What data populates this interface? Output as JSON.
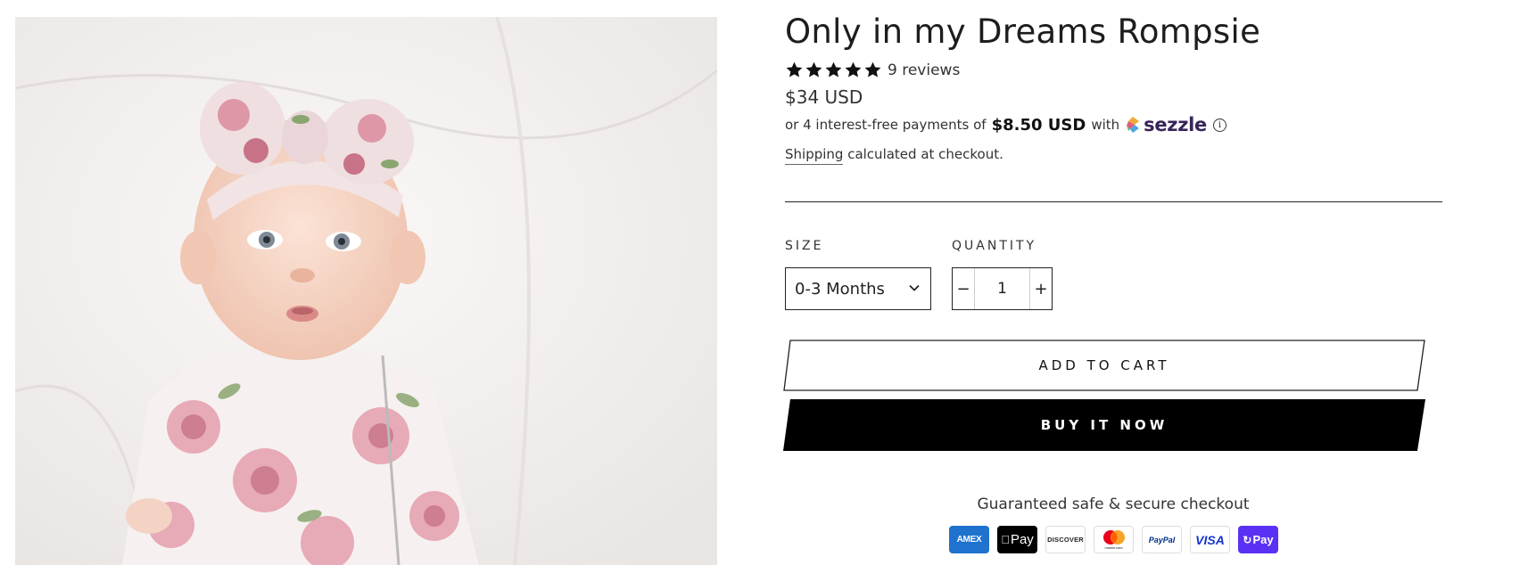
{
  "product": {
    "image_alt": "Baby in floral romper with matching bow headband lying on white sheet",
    "title": "Only in my Dreams Rompsie",
    "rating": {
      "stars": 5,
      "reviews_text": "9 reviews"
    },
    "price": "$34 USD",
    "sezzle": {
      "prefix": "or 4 interest-free payments of",
      "amount": "$8.50 USD",
      "with": "with",
      "brand": "sezzle",
      "info_glyph": "i"
    },
    "shipping": {
      "link": "Shipping",
      "rest": " calculated at checkout."
    }
  },
  "options": {
    "size_label": "SIZE",
    "size_value": "0-3 Months",
    "quantity_label": "QUANTITY",
    "quantity_value": "1",
    "minus": "−",
    "plus": "+"
  },
  "buttons": {
    "add_to_cart": "ADD TO CART",
    "buy_now": "BUY IT NOW"
  },
  "checkout": {
    "secure_text": "Guaranteed safe & secure checkout",
    "payment_icons": [
      {
        "name": "amex-icon",
        "label": "AMEX",
        "bg": "#1f72cd",
        "color": "#ffffff"
      },
      {
        "name": "apple-pay-icon",
        "label": "Pay",
        "bg": "#000000",
        "color": "#ffffff"
      },
      {
        "name": "discover-icon",
        "label": "DISCOVER",
        "bg": "#ffffff",
        "color": "#231f20"
      },
      {
        "name": "mastercard-icon",
        "label": "mastercard",
        "bg": "#ffffff",
        "color": "#231f20"
      },
      {
        "name": "paypal-icon",
        "label": "PayPal",
        "bg": "#ffffff",
        "color": "#003087"
      },
      {
        "name": "visa-icon",
        "label": "VISA",
        "bg": "#ffffff",
        "color": "#1434cb"
      },
      {
        "name": "shop-pay-icon",
        "label": "Pay",
        "bg": "#5a31f4",
        "color": "#ffffff"
      }
    ]
  },
  "colors": {
    "text": "#1c1d1d",
    "buy_now_bg": "#000000",
    "sezzle_purple": "#392558"
  }
}
